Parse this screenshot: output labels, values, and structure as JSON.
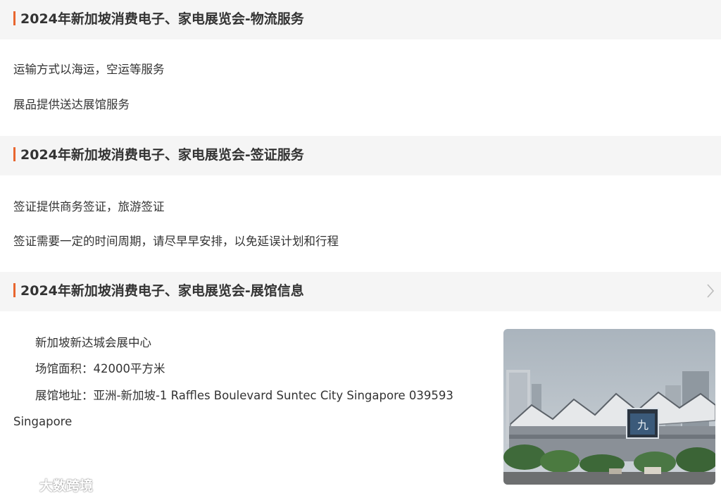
{
  "sections": [
    {
      "title": "2024年新加坡消费电子、家电展览会-物流服务",
      "lines": [
        "运输方式以海运，空运等服务",
        "展品提供送达展馆服务"
      ]
    },
    {
      "title": "2024年新加坡消费电子、家电展览会-签证服务",
      "lines": [
        "签证提供商务签证，旅游签证",
        "签证需要一定的时间周期，请尽早早安排，以免延误计划和行程"
      ]
    },
    {
      "title": "2024年新加坡消费电子、家电展览会-展馆信息",
      "venue_name": "新加坡新达城会展中心",
      "venue_area": "场馆面积：42000平方米",
      "venue_address": "展馆地址：亚洲-新加坡-1 Raffles Boulevard Suntec City Singapore 039593",
      "venue_address_cont": "Singapore"
    }
  ],
  "photo": {
    "icon": "exhibition-center-photo"
  },
  "watermark": {
    "text": "大数跨境",
    "icon": "brand-logo-icon"
  },
  "colors": {
    "accent": "#e8662f",
    "header_bg": "#f5f5f5",
    "text": "#333333"
  }
}
